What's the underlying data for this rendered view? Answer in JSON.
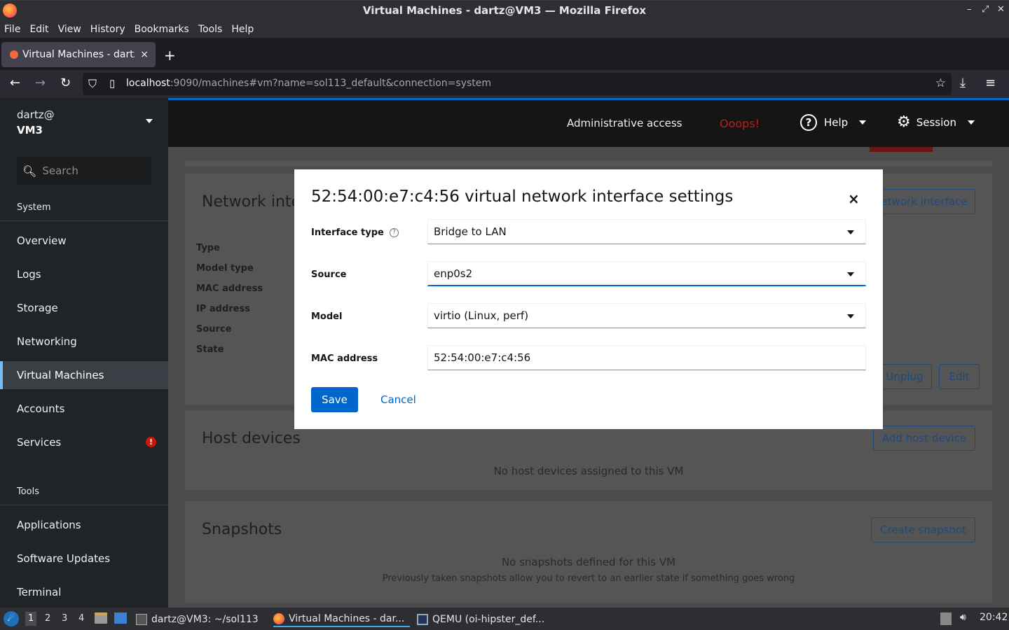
{
  "window": {
    "title": "Virtual Machines - dartz@VM3 — Mozilla Firefox",
    "controls": [
      "–",
      "⤢",
      "✕"
    ]
  },
  "menubar": [
    "File",
    "Edit",
    "View",
    "History",
    "Bookmarks",
    "Tools",
    "Help"
  ],
  "tab": {
    "title": "Virtual Machines - dartz@",
    "close": "×",
    "new": "+"
  },
  "nav": {
    "back": "←",
    "forward": "→",
    "reload": "↻",
    "url_host": "localhost",
    "url_rest": ":9090/machines#vm?name=sol113_default&connection=system",
    "download": "⤓",
    "menu": "≡"
  },
  "sidebar": {
    "user": "dartz@",
    "host": "VM3",
    "search_placeholder": "Search",
    "system_label": "System",
    "tools_label": "Tools",
    "system_items": [
      "Overview",
      "Logs",
      "Storage",
      "Networking",
      "Virtual Machines",
      "Accounts",
      "Services"
    ],
    "tools_items": [
      "Applications",
      "Software Updates",
      "Terminal"
    ],
    "active_item": "Virtual Machines",
    "services_badge": "!"
  },
  "masthead": {
    "admin": "Administrative access",
    "ooops": "Ooops!",
    "help": "Help",
    "session": "Session"
  },
  "background": {
    "network_title": "Network inte",
    "add_network_btn": "etwork interface",
    "labels": [
      "Type",
      "Model type",
      "MAC address",
      "IP address",
      "Source",
      "State"
    ],
    "unplug_btn": "Unplug",
    "edit_btn": "Edit",
    "host_devices_title": "Host devices",
    "add_host_device_btn": "Add host device",
    "no_host_devices": "No host devices assigned to this VM",
    "snapshots_title": "Snapshots",
    "create_snapshot_btn": "Create snapshot",
    "no_snapshots": "No snapshots defined for this VM",
    "snapshots_hint": "Previously taken snapshots allow you to revert to an earlier state if something goes wrong"
  },
  "modal": {
    "title": "52:54:00:e7:c4:56 virtual network interface settings",
    "close": "×",
    "interface_type_label": "Interface type",
    "interface_type_value": "Bridge to LAN",
    "source_label": "Source",
    "source_value": "enp0s2",
    "model_label": "Model",
    "model_value": "virtio (Linux, perf)",
    "mac_label": "MAC address",
    "mac_value": "52:54:00:e7:c4:56",
    "save": "Save",
    "cancel": "Cancel"
  },
  "taskbar": {
    "workspaces": [
      "1",
      "2",
      "3",
      "4"
    ],
    "terminal_task": "dartz@VM3: ~/sol113",
    "firefox_task": "Virtual Machines - dar...",
    "qemu_task": "QEMU (oi-hipster_def...",
    "clock": "20:42"
  }
}
